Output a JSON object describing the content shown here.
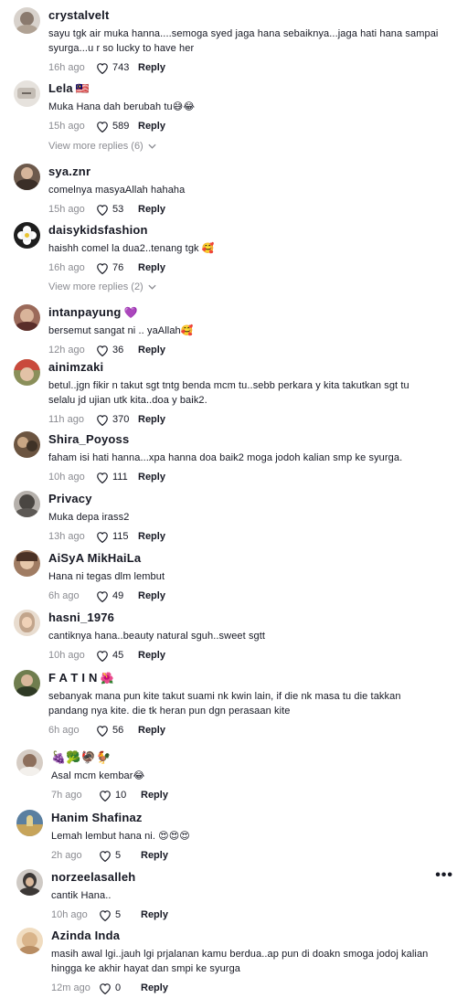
{
  "comments": [
    {
      "user": "crystalvelt",
      "badge": "",
      "text": "sayu tgk air muka hanna....semoga syed jaga hana sebaiknya...jaga hati hana sampai syurga...u r so lucky to have her",
      "time": "16h ago",
      "likes": "743",
      "reply": "Reply",
      "avatar_color": "#d8d2cc"
    },
    {
      "user": "Lela",
      "badge": "🇲🇾",
      "text": "Muka Hana dah berubah tu😅😂",
      "time": "15h ago",
      "likes": "589",
      "reply": "Reply",
      "avatar_color": "#cfc9c2"
    },
    {
      "user": "sya.znr",
      "badge": "",
      "text": "comelnya masyaAllah hahaha",
      "time": "15h ago",
      "likes": "53",
      "reply": "Reply",
      "avatar_color": "#6d5a4c"
    },
    {
      "user": "daisykidsfashion",
      "badge": "",
      "text": "haishh comel la dua2..tenang tgk 🥰",
      "time": "16h ago",
      "likes": "76",
      "reply": "Reply",
      "avatar_color": "#2d2d2d"
    },
    {
      "user": "intanpayung",
      "badge": "💜",
      "text": "bersemut sangat ni .. yaAllah🥰",
      "time": "12h ago",
      "likes": "36",
      "reply": "Reply",
      "avatar_color": "#9b6a5a"
    },
    {
      "user": "ainimzaki",
      "badge": "",
      "text": "betul..jgn fikir n takut sgt tntg benda mcm tu..sebb perkara y kita takutkan sgt tu selalu jd ujian utk kita..doa y baik2.",
      "time": "11h ago",
      "likes": "370",
      "reply": "Reply",
      "avatar_color": "#8a8f5a"
    },
    {
      "user": "Shira_Poyoss",
      "badge": "",
      "text": "faham isi hati hanna...xpa hanna doa baik2 moga jodoh kalian smp ke syurga.",
      "time": "10h ago",
      "likes": "111",
      "reply": "Reply",
      "avatar_color": "#6b5440"
    },
    {
      "user": "Privacy",
      "badge": "",
      "text": "Muka depa irass2",
      "time": "13h ago",
      "likes": "115",
      "reply": "Reply",
      "avatar_color": "#7a7570"
    },
    {
      "user": "AiSyA MikHaiLa",
      "badge": "",
      "text": "Hana ni tegas dlm lembut",
      "time": "6h ago",
      "likes": "49",
      "reply": "Reply",
      "avatar_color": "#a07c63"
    },
    {
      "user": "hasni_1976",
      "badge": "",
      "text": "cantiknya hana..beauty natural sguh..sweet sgtt",
      "time": "10h ago",
      "likes": "45",
      "reply": "Reply",
      "avatar_color": "#c2a58c"
    },
    {
      "user": "F A T I N",
      "badge": "🌺",
      "text": "sebanyak mana pun kite takut suami nk kwin lain, if die nk masa tu die takkan pandang nya kite. die tk heran pun dgn perasaan kite",
      "time": "6h ago",
      "likes": "56",
      "reply": "Reply",
      "avatar_color": "#6f7d4e"
    },
    {
      "user": "🍇🥦🦃🐓",
      "badge": "",
      "text": "Asal mcm kembar😂",
      "time": "7h ago",
      "likes": "10",
      "reply": "Reply",
      "avatar_color": "#b8a79a"
    },
    {
      "user": "Hanim Shafinaz",
      "badge": "",
      "text": "Lemah lembut hana ni. 😍😍😍",
      "time": "2h ago",
      "likes": "5",
      "reply": "Reply",
      "avatar_color": "#5a7fa0"
    },
    {
      "user": "norzeelasalleh",
      "badge": "",
      "text": "cantik Hana..",
      "time": "10h ago",
      "likes": "5",
      "reply": "Reply",
      "avatar_color": "#6e6a66"
    },
    {
      "user": "Azinda Inda",
      "badge": "",
      "text": "masih awal lgi..jauh lgi prjalanan kamu berdua..ap pun di doakn smoga jodoj kalian hingga ke akhir hayat dan smpi ke syurga",
      "time": "12m ago",
      "likes": "0",
      "reply": "Reply",
      "avatar_color": "#d9b48a"
    }
  ],
  "more_replies": [
    {
      "label": "View more replies (6)"
    },
    {
      "label": "View more replies (2)"
    }
  ],
  "more_options": "•••"
}
